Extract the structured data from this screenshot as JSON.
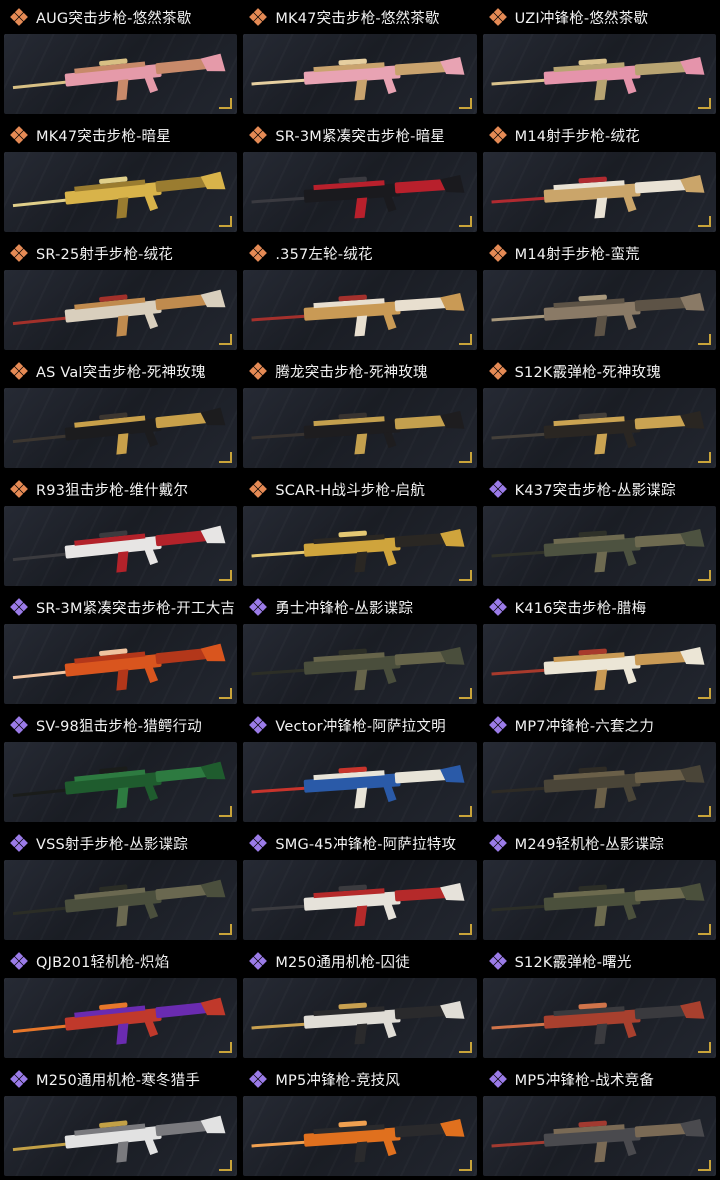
{
  "colors": {
    "orange_rarity": "#e58a55",
    "purple_rarity": "#9b7be8",
    "corner_mark": "#c9a43a"
  },
  "items": [
    {
      "title": "AUG突击步枪-悠然茶歇",
      "rarity": "orange",
      "skin": [
        "#e59aa9",
        "#c88a6a",
        "#d8c084"
      ]
    },
    {
      "title": "MK47突击步枪-悠然茶歇",
      "rarity": "orange",
      "skin": [
        "#e8a3b3",
        "#c9a36e",
        "#e6cfa0"
      ]
    },
    {
      "title": "UZI冲锋枪-悠然茶歇",
      "rarity": "orange",
      "skin": [
        "#e594ab",
        "#b8a472",
        "#d9c28c"
      ]
    },
    {
      "title": "MK47突击步枪-暗星",
      "rarity": "orange",
      "skin": [
        "#d8b34a",
        "#9a7c30",
        "#e0cf8a"
      ]
    },
    {
      "title": "SR-3M紧凑突击步枪-暗星",
      "rarity": "orange",
      "skin": [
        "#1a1a1e",
        "#b8202c",
        "#3a3a40"
      ]
    },
    {
      "title": "M14射手步枪-绒花",
      "rarity": "orange",
      "skin": [
        "#caa56a",
        "#e9e2d4",
        "#b02a30"
      ]
    },
    {
      "title": "SR-25射手步枪-绒花",
      "rarity": "orange",
      "skin": [
        "#d9cfbd",
        "#c08b4e",
        "#a2302a"
      ]
    },
    {
      "title": ".357左轮-绒花",
      "rarity": "orange",
      "skin": [
        "#c99a55",
        "#e8dfcf",
        "#a4302c"
      ]
    },
    {
      "title": "M14射手步枪-蛮荒",
      "rarity": "orange",
      "skin": [
        "#8a7a66",
        "#5d5346",
        "#a8987c"
      ]
    },
    {
      "title": "AS Val突击步枪-死神玫瑰",
      "rarity": "orange",
      "skin": [
        "#1c1c1e",
        "#c8a04a",
        "#3c3630"
      ]
    },
    {
      "title": "腾龙突击步枪-死神玫瑰",
      "rarity": "orange",
      "skin": [
        "#1e1d1f",
        "#c4a04e",
        "#383330"
      ]
    },
    {
      "title": "S12K霰弹枪-死神玫瑰",
      "rarity": "orange",
      "skin": [
        "#2a2622",
        "#caa352",
        "#45403a"
      ]
    },
    {
      "title": "R93狙击步枪-维什戴尔",
      "rarity": "orange",
      "skin": [
        "#e7e5e4",
        "#b3222a",
        "#3b3b3f"
      ]
    },
    {
      "title": "SCAR-H战斗步枪-启航",
      "rarity": "orange",
      "skin": [
        "#cfa43c",
        "#2a2723",
        "#e4c873"
      ]
    },
    {
      "title": "K437突击步枪-丛影谍踪",
      "rarity": "purple",
      "skin": [
        "#4d5240",
        "#6e6a50",
        "#2f3129"
      ]
    },
    {
      "title": "SR-3M紧凑突击步枪-开工大吉",
      "rarity": "purple",
      "skin": [
        "#d9551e",
        "#b3371a",
        "#f0c4a0"
      ]
    },
    {
      "title": "勇士冲锋枪-丛影谍踪",
      "rarity": "purple",
      "skin": [
        "#4a4e3c",
        "#66644a",
        "#2c2e26"
      ]
    },
    {
      "title": "K416突击步枪-腊梅",
      "rarity": "purple",
      "skin": [
        "#ece6d6",
        "#c99a55",
        "#a83a2c"
      ]
    },
    {
      "title": "SV-98狙击步枪-猎鳄行动",
      "rarity": "purple",
      "skin": [
        "#1f5c2e",
        "#2d7a40",
        "#1a1c1a"
      ]
    },
    {
      "title": "Vector冲锋枪-阿萨拉文明",
      "rarity": "purple",
      "skin": [
        "#2a5aa8",
        "#e8e4d8",
        "#c8342c"
      ]
    },
    {
      "title": "MP7冲锋枪-六套之力",
      "rarity": "purple",
      "skin": [
        "#4a4538",
        "#6a5f48",
        "#2e2b25"
      ]
    },
    {
      "title": "VSS射手步枪-丛影谍踪",
      "rarity": "purple",
      "skin": [
        "#4b4f3d",
        "#6a6850",
        "#2b2d26"
      ]
    },
    {
      "title": "SMG-45冲锋枪-阿萨拉特攻",
      "rarity": "purple",
      "skin": [
        "#e6e2da",
        "#b52a2a",
        "#3b3b3f"
      ]
    },
    {
      "title": "M249轻机枪-丛影谍踪",
      "rarity": "purple",
      "skin": [
        "#4b503c",
        "#6c6a4e",
        "#2c2e27"
      ]
    },
    {
      "title": "QJB201轻机枪-炽焰",
      "rarity": "purple",
      "skin": [
        "#c0392b",
        "#6a2bb0",
        "#e7772a"
      ]
    },
    {
      "title": "M250通用机枪-囚徒",
      "rarity": "purple",
      "skin": [
        "#e0ddd6",
        "#2a2a2c",
        "#c8a050"
      ]
    },
    {
      "title": "S12K霰弹枪-曙光",
      "rarity": "purple",
      "skin": [
        "#a8402e",
        "#3a3a3e",
        "#d0744a"
      ]
    },
    {
      "title": "M250通用机枪-寒冬猎手",
      "rarity": "purple",
      "skin": [
        "#e2e2e2",
        "#7a7a7e",
        "#c2a046"
      ]
    },
    {
      "title": "MP5冲锋枪-竞技风",
      "rarity": "purple",
      "skin": [
        "#e0701e",
        "#2a2a2c",
        "#f0a050"
      ]
    },
    {
      "title": "MP5冲锋枪-战术竞备",
      "rarity": "purple",
      "skin": [
        "#4a4a4e",
        "#7a6a55",
        "#a23a30"
      ]
    }
  ]
}
